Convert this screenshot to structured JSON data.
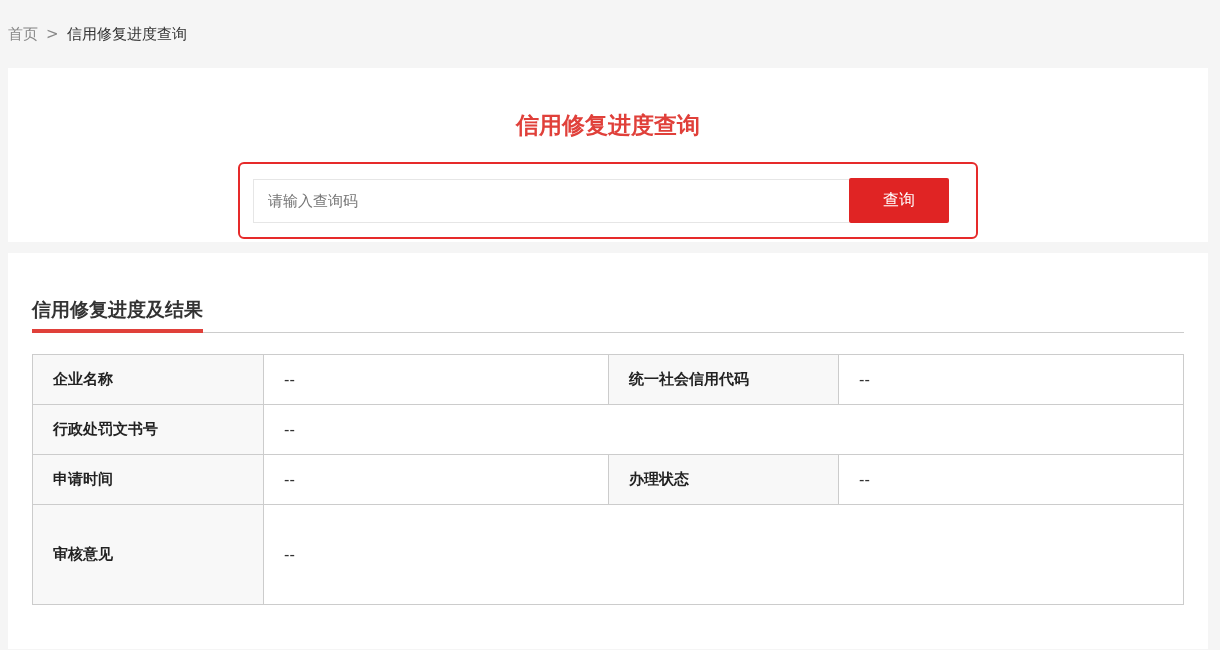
{
  "breadcrumb": {
    "items": [
      {
        "label": "首页",
        "selected": false
      },
      {
        "label": "信用修复进度查询",
        "selected": true
      }
    ],
    "separator": ">"
  },
  "search_panel": {
    "title": "信用修复进度查询",
    "placeholder": "请输入查询码",
    "button": "查询"
  },
  "result_section": {
    "heading": "信用修复进度及结果",
    "rows": [
      {
        "kind": "pair",
        "cells": [
          {
            "label": "企业名称",
            "value": "--"
          },
          {
            "label": "统一社会信用代码",
            "value": "--"
          }
        ]
      },
      {
        "kind": "wide",
        "cells": [
          {
            "label": "行政处罚文书号",
            "value": "--"
          }
        ]
      },
      {
        "kind": "pair",
        "cells": [
          {
            "label": "申请时间",
            "value": "--"
          },
          {
            "label": "办理状态",
            "value": "--"
          }
        ]
      },
      {
        "kind": "tall",
        "cells": [
          {
            "label": "审核意见",
            "value": "--"
          }
        ]
      }
    ]
  }
}
